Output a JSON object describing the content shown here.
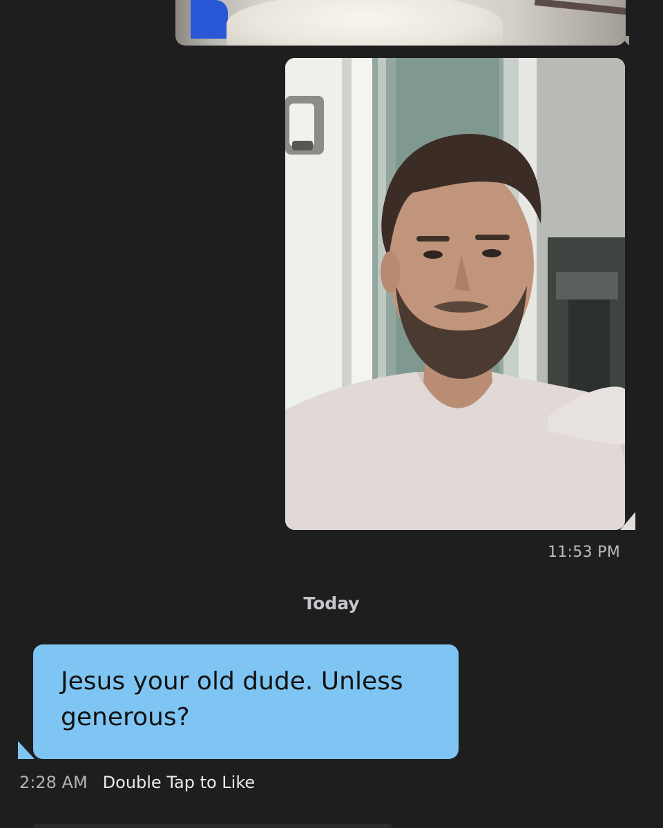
{
  "messages": {
    "sent_photo_time": "11:53 PM",
    "day_divider": "Today",
    "received": {
      "text": "Jesus your old dude. Unless generous?",
      "time": "2:28 AM",
      "like_hint": "Double Tap to Like"
    }
  },
  "colors": {
    "background": "#1e1e1f",
    "incoming_bubble": "#7fc5f3",
    "timestamp": "#bdbcc0"
  }
}
